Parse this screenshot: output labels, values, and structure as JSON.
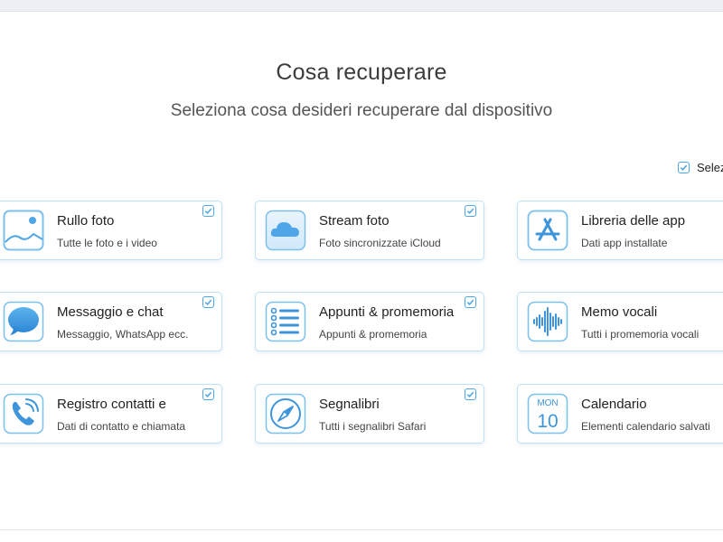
{
  "header": {
    "title": "Cosa recuperare",
    "subtitle": "Seleziona cosa desideri recuperare dal dispositivo"
  },
  "select_all": {
    "label": "Selez",
    "checked": true
  },
  "accent_color": "#4ea6e8",
  "categories": [
    {
      "label": "Rullo foto",
      "desc": "Tutte le foto e i video",
      "icon": "photo-icon",
      "checked": true
    },
    {
      "label": "Stream foto",
      "desc": "Foto sincronizzate iCloud",
      "icon": "cloud-icon",
      "checked": true
    },
    {
      "label": "Libreria delle app",
      "desc": "Dati app installate",
      "icon": "app-store-icon",
      "checked": false
    },
    {
      "label": "Messaggio e chat",
      "desc": "Messaggio, WhatsApp ecc.",
      "icon": "message-bubble-icon",
      "checked": true
    },
    {
      "label": "Appunti & promemoria",
      "desc": "Appunti & promemoria",
      "icon": "notes-list-icon",
      "checked": true
    },
    {
      "label": "Memo vocali",
      "desc": "Tutti i promemoria vocali",
      "icon": "voice-memo-waveform-icon",
      "checked": false
    },
    {
      "label": "Registro contatti e",
      "desc": "Dati di contatto e chiamata",
      "icon": "phone-icon",
      "checked": true
    },
    {
      "label": "Segnalibri",
      "desc": "Tutti i segnalibri Safari",
      "icon": "compass-icon",
      "checked": true
    },
    {
      "label": "Calendario",
      "desc": "Elementi calendario salvati",
      "icon": "calendar-icon",
      "checked": false,
      "icon_text": {
        "month": "MON",
        "day": "10"
      }
    }
  ]
}
